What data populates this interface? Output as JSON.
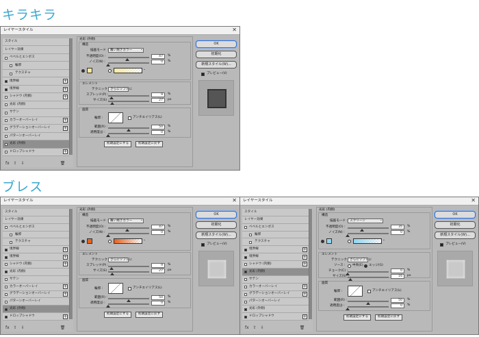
{
  "titles": [
    "キラキラ",
    "ブレス"
  ],
  "dialog_title": "レイヤースタイル",
  "layer_styles": [
    "スタイル",
    "レイヤー効果",
    "ベベルとエンボス",
    "輪郭",
    "テクスチャ",
    "境界線",
    "境界線",
    "シャドウ (内側)",
    "光彩 (内側)",
    "サテン",
    "カラーオーバーレイ",
    "グラデーションオーバーレイ",
    "パターンオーバーレイ",
    "光彩 (外側)",
    "ドロップシャドウ"
  ],
  "section": {
    "title": "光彩 (外側)",
    "structure": "構造",
    "elements": "エレメント",
    "quality": "画質"
  },
  "labels": {
    "blend_mode": "描画モード :",
    "opacity": "不透明度(O) :",
    "noise": "ノイズ(N) :",
    "technique": "テクニック :",
    "spread": "スプレッド(P) :",
    "size": "サイズ(S) :",
    "contour": "輪郭 :",
    "anti_alias": "アンチエイリアス(L)",
    "range": "範囲(R) :",
    "jitter": "適用度(J) :",
    "source": "ソース :",
    "source_center": "中央(E)",
    "source_edge": "エッジ(G)",
    "choke": "チョーク(C) :",
    "unit": "px",
    "pct": "%"
  },
  "buttons": {
    "ok": "OK",
    "reset": "初期化",
    "new_style": "新規スタイル(W)...",
    "preview": "プレビュー(V)",
    "make_default": "初期設定にする",
    "reset_default": "初期設定に戻す"
  },
  "icons": [
    "fx-icon",
    "arrow-up-icon",
    "arrow-down-icon",
    "trash-icon"
  ],
  "dialogs": [
    {
      "selected": "光彩 (外側)",
      "checked": [
        "境界線",
        "境界線"
      ],
      "blend_mode": "覆い焼きカラー",
      "opacity": "47",
      "noise": "0",
      "technique": "さらにソフトに",
      "spread": "9",
      "size": "27",
      "range": "50",
      "jitter": "0",
      "color": "#f5e69a",
      "gradient_from": "#f7e9a5",
      "preview_fill": "#555555"
    },
    {
      "selected": "光彩 (外側)",
      "checked": [
        "境界線",
        "境界線",
        "光彩 (内側)",
        "光彩 (外側)",
        "ドロップシャドウ"
      ],
      "blend_mode": "覆い焼きカラー",
      "opacity": "47",
      "noise": "0",
      "technique": "さらにソフトに",
      "spread": "9",
      "size": "27",
      "range": "50",
      "jitter": "0",
      "color": "#e8621f",
      "gradient_from": "#e8621f",
      "preview_fill": "#c9c9c9"
    },
    {
      "selected": "光彩 (内側)",
      "checked": [
        "境界線",
        "境界線",
        "光彩 (内側)",
        "光彩 (外側)",
        "ドロップシャドウ"
      ],
      "blend_mode": "スクリーン",
      "opacity": "35",
      "noise": "0",
      "technique": "さらにソフトに",
      "choke": "0",
      "size": "16",
      "range": "50",
      "jitter": "0",
      "color": "#8fd6f2",
      "gradient_from": "#8fd6f2",
      "preview_fill": "#c9c9c9",
      "section_title": "光彩 (内側)"
    }
  ]
}
